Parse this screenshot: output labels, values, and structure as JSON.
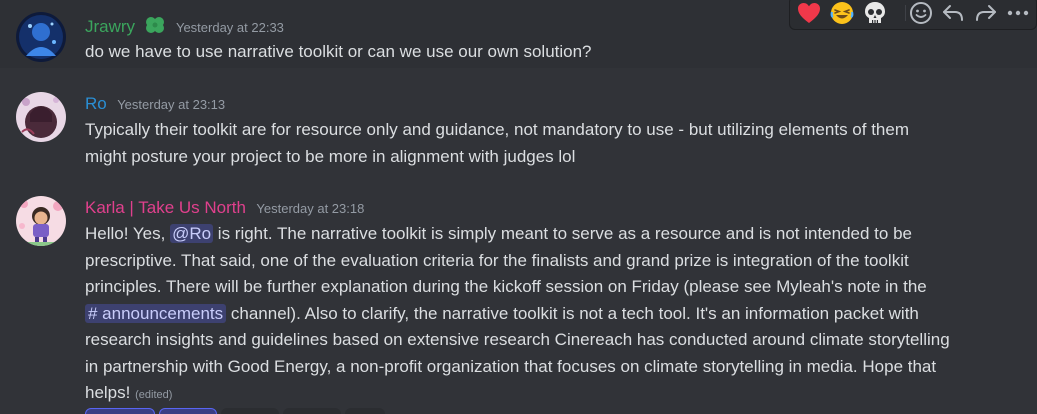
{
  "messages": [
    {
      "username": "Jrawry",
      "username_color": "#3ba55d",
      "timestamp": "Yesterday at 22:33",
      "text": "do we have to use narrative toolkit or can we use our own solution?"
    },
    {
      "username": "Ro",
      "username_color": "#2a8fd4",
      "timestamp": "Yesterday at 23:13",
      "line1": "Typically their toolkit are for resource only and guidance, not mandatory to use - but utilizing elements of them",
      "line2": "might posture your project to be more in alignment with judges lol"
    },
    {
      "username": "Karla | Take Us North",
      "username_color": "#e0408d",
      "timestamp": "Yesterday at 23:18",
      "l1_pre": "Hello! Yes, ",
      "l1_mention": "@Ro",
      "l1_post": " is right. The narrative toolkit is simply meant to serve as a resource and is not intended to be",
      "l2": "prescriptive. That said, one of the evaluation criteria for the finalists and grand prize is integration of the toolkit",
      "l3": "principles. There will be further explanation during the kickoff session on Friday (please see Myleah's note in the",
      "l4_channel": "# announcements",
      "l4_post": " channel). Also to clarify, the narrative toolkit is not a tech tool. It's an information packet with",
      "l5": "research insights and guidelines based on extensive research Cinereach has conducted around climate storytelling",
      "l6": "in partnership with Good Energy, a non-profit organization that focuses on climate storytelling in media. Hope that",
      "l7": "helps!",
      "edited": "(edited)"
    }
  ],
  "toolbar": {
    "items": [
      "heart-reaction",
      "laughing-reaction",
      "skull-reaction",
      "add-reaction",
      "reply",
      "forward",
      "more"
    ]
  },
  "colors": {
    "background": "#313338",
    "hover": "#2e3035",
    "text": "#dbdee1",
    "muted": "#949ba4",
    "mention_bg": "#5865f2"
  }
}
